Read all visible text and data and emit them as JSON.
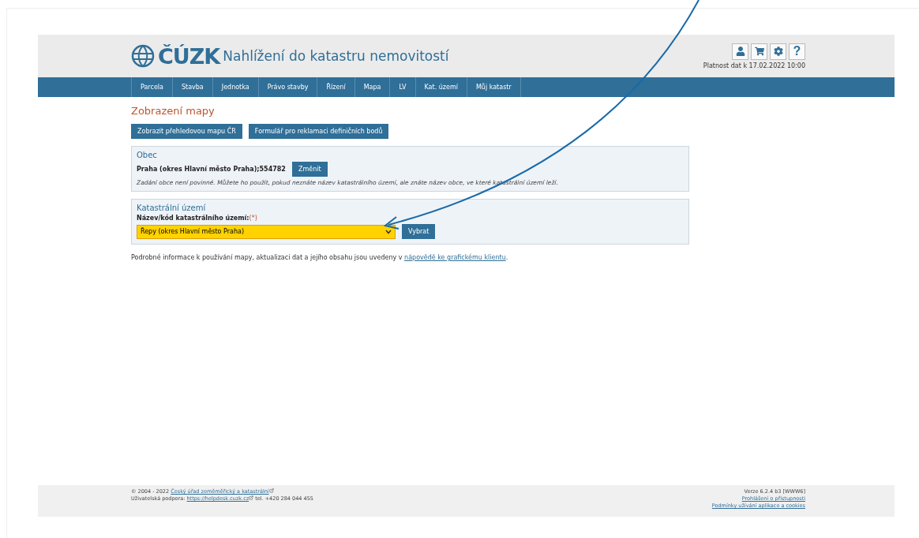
{
  "header": {
    "logo": "ČÚZK",
    "title": "Nahlížení do katastru nemovitostí",
    "tools": [
      {
        "kind": "user"
      },
      {
        "kind": "cart"
      },
      {
        "kind": "settings"
      },
      {
        "kind": "help"
      }
    ],
    "help_label": "?",
    "validity": "Platnost dat k 17.02.2022 10:00"
  },
  "nav": [
    {
      "label": "Parcela"
    },
    {
      "label": "Stavba"
    },
    {
      "label": "Jednotka"
    },
    {
      "label": "Právo stavby"
    },
    {
      "label": "Řízení"
    },
    {
      "label": "Mapa"
    },
    {
      "label": "LV"
    },
    {
      "label": "Kat. území"
    },
    {
      "label": "Můj katastr"
    }
  ],
  "page_title": "Zobrazení mapy",
  "actions": [
    "Zobrazit přehledovou mapu ČR",
    "Formulář pro reklamaci definičních bodů"
  ],
  "obec": {
    "heading": "Obec",
    "value": "Praha (okres Hlavní město Praha);554782",
    "button": "Změnit",
    "note": "Zadání obce není povinné. Můžete ho použít, pokud neznáte název katastrálního území, ale znáte název obce, ve které katastrální území leží."
  },
  "katastr": {
    "heading": "Katastrální území",
    "label": "Název/kód katastrálního území:",
    "required": "(*)",
    "value": "Řepy (okres Hlavní město Praha)",
    "button": "Vybrat"
  },
  "info": {
    "text": "Podrobné informace k používání mapy, aktualizaci dat a jejího obsahu jsou uvedeny v ",
    "link": "nápovědě ke grafickému klientu",
    "end": "."
  },
  "footer": {
    "copyright": "© 2004 - 2022 ",
    "office_link": "Český úřad zeměměřický a katastrální",
    "support": "Uživatelská podpora: ",
    "support_link": "https://helpdesk.cuzk.cz",
    "phone": " tel. +420 284 044 455",
    "version": "Verze 6.2.4 b3 [WWW6]",
    "links": [
      "Prohlášení o přístupnosti",
      "Podmínky užívání aplikace a cookies"
    ]
  }
}
